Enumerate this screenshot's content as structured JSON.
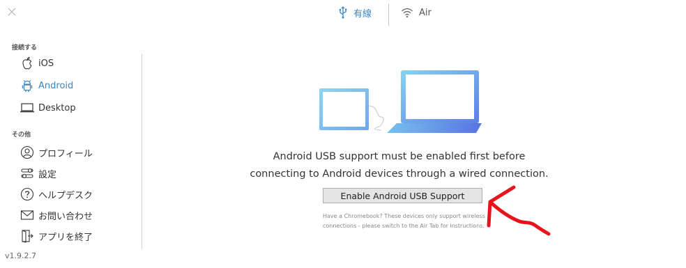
{
  "window": {
    "close_icon": "close-icon"
  },
  "tabs": [
    {
      "label": "有線",
      "icon": "usb-icon",
      "active": true
    },
    {
      "label": "Air",
      "icon": "wifi-icon",
      "active": false
    }
  ],
  "sidebar": {
    "connect_heading": "接続する",
    "connect_items": [
      {
        "label": "iOS",
        "icon": "apple-icon"
      },
      {
        "label": "Android",
        "icon": "android-icon",
        "active": true
      },
      {
        "label": "Desktop",
        "icon": "laptop-icon"
      }
    ],
    "other_heading": "その他",
    "other_items": [
      {
        "label": "プロフィール",
        "icon": "user-icon"
      },
      {
        "label": "設定",
        "icon": "settings-sliders-icon"
      },
      {
        "label": "ヘルプデスク",
        "icon": "help-icon"
      },
      {
        "label": "お問い合わせ",
        "icon": "mail-icon"
      },
      {
        "label": "アプリを終了",
        "icon": "exit-icon"
      }
    ],
    "version": "v1.9.2.7"
  },
  "main": {
    "message_line1": "Android USB support must be enabled first before",
    "message_line2": "connecting to Android devices through a wired connection.",
    "enable_button_label": "Enable Android USB Support",
    "hint_line1": "Have a Chromebook? These devices only support wireless",
    "hint_line2": "connections - please switch to the Air Tab for instructions."
  },
  "colors": {
    "accent": "#3a86c3",
    "annotation": "#e8131b"
  }
}
